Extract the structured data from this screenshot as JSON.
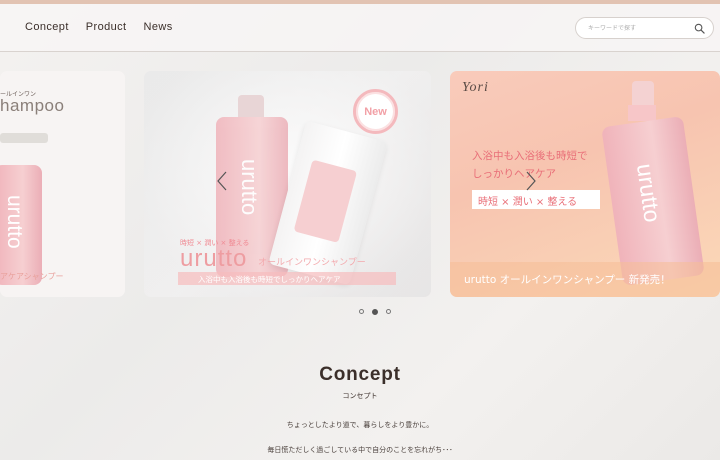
{
  "header": {
    "nav": [
      {
        "label": "Concept"
      },
      {
        "label": "Product"
      },
      {
        "label": "News"
      }
    ],
    "search": {
      "placeholder": "キーワードで探す",
      "icon": "search-icon"
    }
  },
  "slides": {
    "left": {
      "top_label": "ールインワン",
      "title_fragment": "hampoo",
      "bottle_text": "urutto",
      "bottom_text": "アケアシャンプー"
    },
    "middle": {
      "badge": "New",
      "tagline": "時短 × 潤い × 整える",
      "brand": "urutto",
      "product": "オールインワンシャンプー",
      "banner": "入浴中も入浴後も時短でしっかりヘアケア",
      "bottle_text": "urutto"
    },
    "right": {
      "logo": "Yori",
      "headline_1": "入浴中も入浴後も時短で",
      "headline_2": "しっかりヘアケア",
      "tagline": "時短 × 潤い × 整える",
      "bottom": "urutto オールインワンシャンプー 新発売！",
      "bottle_text": "urutto"
    }
  },
  "carousel": {
    "current": 2,
    "total": 3
  },
  "concept": {
    "title": "Concept",
    "subtitle": "コンセプト",
    "line1": "ちょっとしたより道で、暮らしをより豊かに。",
    "line2": "毎日慌ただしく過ごしている中で自分のことを忘れがち･･･"
  },
  "colors": {
    "accent": "#e2c3b2",
    "pink": "#f08a93",
    "text": "#3b2f2a"
  }
}
